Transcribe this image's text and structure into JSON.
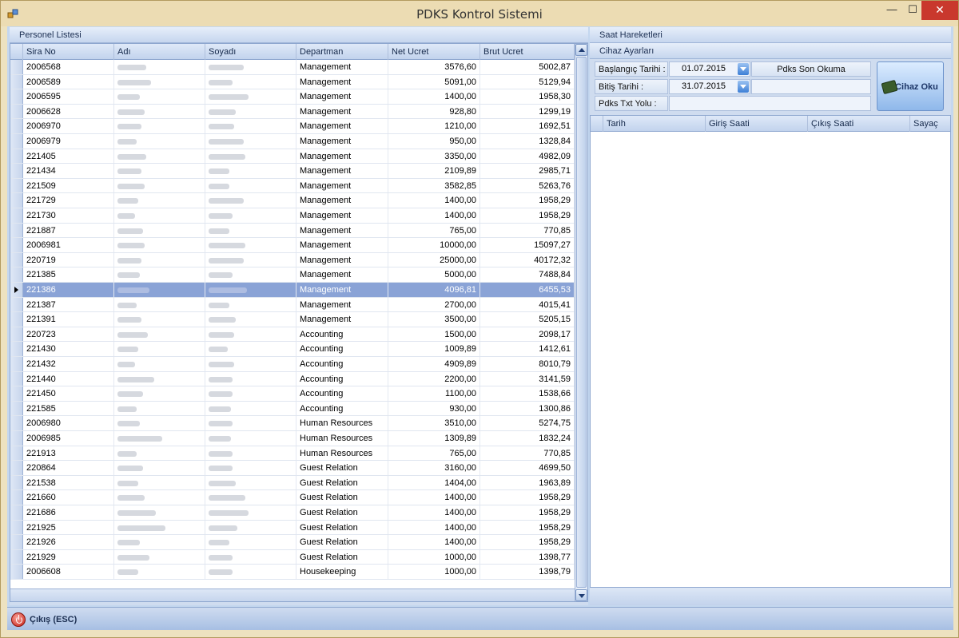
{
  "window": {
    "title": "PDKS Kontrol Sistemi",
    "min_glyph": "—",
    "max_glyph": "☐",
    "close_glyph": "✕"
  },
  "left": {
    "title": "Personel Listesi",
    "columns": [
      "Sira No",
      "Adı",
      "Soyadı",
      "Departman",
      "Net Ucret",
      "Brut Ucret"
    ],
    "rows": [
      {
        "no": "2006568",
        "dept": "Management",
        "net": "3576,60",
        "brut": "5002,87"
      },
      {
        "no": "2006589",
        "dept": "Management",
        "net": "5091,00",
        "brut": "5129,94"
      },
      {
        "no": "2006595",
        "dept": "Management",
        "net": "1400,00",
        "brut": "1958,30"
      },
      {
        "no": "2006628",
        "dept": "Management",
        "net": "928,80",
        "brut": "1299,19"
      },
      {
        "no": "2006970",
        "dept": "Management",
        "net": "1210,00",
        "brut": "1692,51"
      },
      {
        "no": "2006979",
        "dept": "Management",
        "net": "950,00",
        "brut": "1328,84"
      },
      {
        "no": "221405",
        "dept": "Management",
        "net": "3350,00",
        "brut": "4982,09"
      },
      {
        "no": "221434",
        "dept": "Management",
        "net": "2109,89",
        "brut": "2985,71"
      },
      {
        "no": "221509",
        "dept": "Management",
        "net": "3582,85",
        "brut": "5263,76"
      },
      {
        "no": "221729",
        "dept": "Management",
        "net": "1400,00",
        "brut": "1958,29"
      },
      {
        "no": "221730",
        "dept": "Management",
        "net": "1400,00",
        "brut": "1958,29"
      },
      {
        "no": "221887",
        "dept": "Management",
        "net": "765,00",
        "brut": "770,85"
      },
      {
        "no": "2006981",
        "dept": "Management",
        "net": "10000,00",
        "brut": "15097,27"
      },
      {
        "no": "220719",
        "dept": "Management",
        "net": "25000,00",
        "brut": "40172,32"
      },
      {
        "no": "221385",
        "dept": "Management",
        "net": "5000,00",
        "brut": "7488,84"
      },
      {
        "no": "221386",
        "dept": "Management",
        "net": "4096,81",
        "brut": "6455,53"
      },
      {
        "no": "221387",
        "dept": "Management",
        "net": "2700,00",
        "brut": "4015,41"
      },
      {
        "no": "221391",
        "dept": "Management",
        "net": "3500,00",
        "brut": "5205,15"
      },
      {
        "no": "220723",
        "dept": "Accounting",
        "net": "1500,00",
        "brut": "2098,17"
      },
      {
        "no": "221430",
        "dept": "Accounting",
        "net": "1009,89",
        "brut": "1412,61"
      },
      {
        "no": "221432",
        "dept": "Accounting",
        "net": "4909,89",
        "brut": "8010,79"
      },
      {
        "no": "221440",
        "dept": "Accounting",
        "net": "2200,00",
        "brut": "3141,59"
      },
      {
        "no": "221450",
        "dept": "Accounting",
        "net": "1100,00",
        "brut": "1538,66"
      },
      {
        "no": "221585",
        "dept": "Accounting",
        "net": "930,00",
        "brut": "1300,86"
      },
      {
        "no": "2006980",
        "dept": "Human Resources",
        "net": "3510,00",
        "brut": "5274,75"
      },
      {
        "no": "2006985",
        "dept": "Human Resources",
        "net": "1309,89",
        "brut": "1832,24"
      },
      {
        "no": "221913",
        "dept": "Human Resources",
        "net": "765,00",
        "brut": "770,85"
      },
      {
        "no": "220864",
        "dept": "Guest Relation",
        "net": "3160,00",
        "brut": "4699,50"
      },
      {
        "no": "221538",
        "dept": "Guest Relation",
        "net": "1404,00",
        "brut": "1963,89"
      },
      {
        "no": "221660",
        "dept": "Guest Relation",
        "net": "1400,00",
        "brut": "1958,29"
      },
      {
        "no": "221686",
        "dept": "Guest Relation",
        "net": "1400,00",
        "brut": "1958,29"
      },
      {
        "no": "221925",
        "dept": "Guest Relation",
        "net": "1400,00",
        "brut": "1958,29"
      },
      {
        "no": "221926",
        "dept": "Guest Relation",
        "net": "1400,00",
        "brut": "1958,29"
      },
      {
        "no": "221929",
        "dept": "Guest Relation",
        "net": "1000,00",
        "brut": "1398,77"
      },
      {
        "no": "2006608",
        "dept": "Housekeeping",
        "net": "1000,00",
        "brut": "1398,79"
      }
    ],
    "selected_no": "221386"
  },
  "right": {
    "title": "Saat Hareketleri",
    "settings_title": "Cihaz Ayarları",
    "start_label": "Başlangıç Tarihi :",
    "start_value": "01.07.2015",
    "end_label": "Bitiş Tarihi :",
    "end_value": "31.07.2015",
    "path_label": "Pdks Txt Yolu :",
    "last_read_label": "Pdks Son Okuma",
    "read_button": "Cihaz Oku",
    "columns": [
      "Tarih",
      "Giriş Saati",
      "Çıkış Saati",
      "Sayaç"
    ]
  },
  "bottom": {
    "exit_label": "Çıkış (ESC)"
  }
}
